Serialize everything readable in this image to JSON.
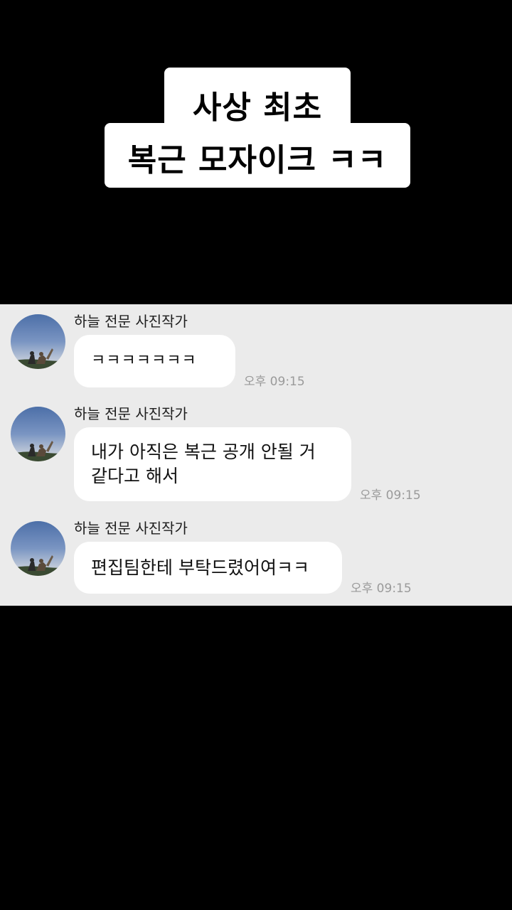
{
  "caption": {
    "line1": "사상 최초",
    "line2": "복근 모자이크 ㅋㅋ"
  },
  "chat": {
    "messages": [
      {
        "sender": "하늘 전문 사진작가",
        "lines": [
          "ㅋㅋㅋㅋㅋㅋㅋ"
        ],
        "time": "오후 09:15"
      },
      {
        "sender": "하늘 전문 사진작가",
        "lines": [
          "내가 아직은 복근 공개 안될 거",
          "같다고 해서"
        ],
        "time": "오후 09:15"
      },
      {
        "sender": "하늘 전문 사진작가",
        "lines": [
          "편집팀한테 부탁드렸어여ㅋㅋ"
        ],
        "time": "오후 09:15"
      }
    ]
  },
  "colors": {
    "background": "#000000",
    "chat_panel": "#ebebeb",
    "bubble": "#ffffff",
    "timestamp": "#9a9a9a"
  },
  "icons": {
    "avatar": "sky-photo-avatar"
  }
}
